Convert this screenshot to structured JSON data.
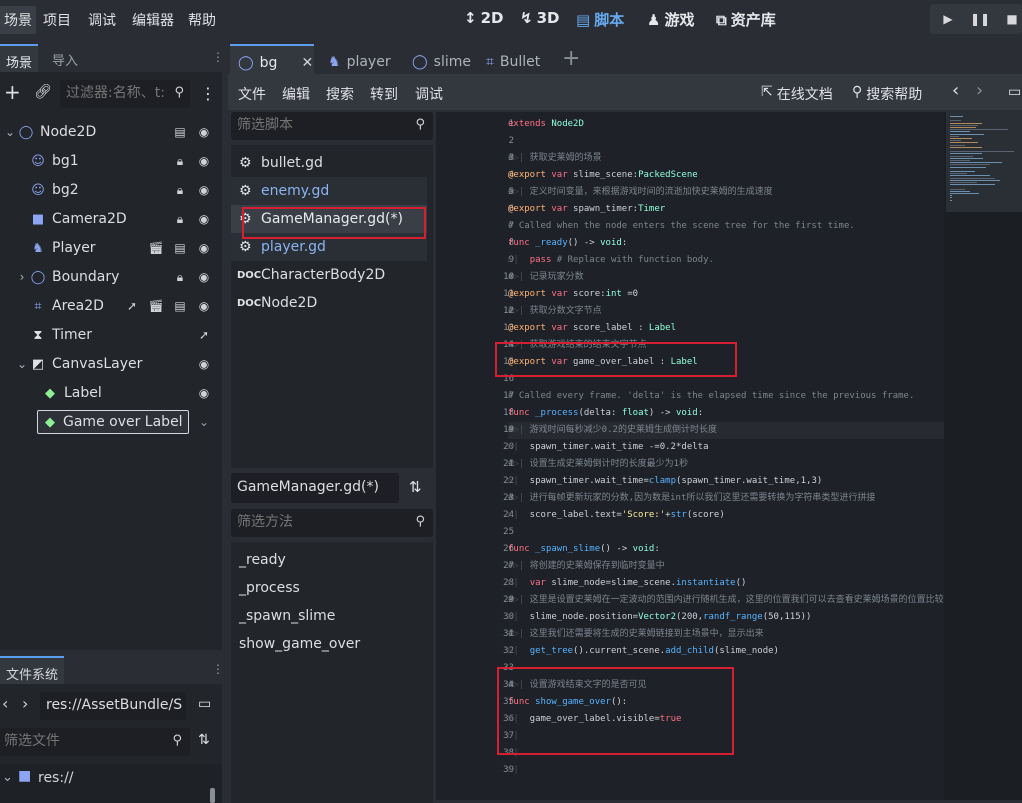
{
  "menu": {
    "items": [
      "场景",
      "项目",
      "调试",
      "编辑器",
      "帮助"
    ],
    "modes": [
      {
        "label": "2D",
        "icon": "2d-mode-icon"
      },
      {
        "label": "3D",
        "icon": "3d-mode-icon"
      },
      {
        "label": "脚本",
        "icon": "script-mode-icon"
      },
      {
        "label": "游戏",
        "icon": "game-mode-icon"
      },
      {
        "label": "资产库",
        "icon": "assetlib-icon"
      }
    ]
  },
  "scene_dock": {
    "tabs": [
      "场景",
      "导入"
    ],
    "filter_placeholder": "过滤器:名称、t:",
    "nodes": [
      {
        "name": "Node2D",
        "icon": "node2d-circle-icon"
      },
      {
        "name": "bg1",
        "icon": "sprite-icon"
      },
      {
        "name": "bg2",
        "icon": "sprite-icon"
      },
      {
        "name": "Camera2D",
        "icon": "camera-icon"
      },
      {
        "name": "Player",
        "icon": "character-icon"
      },
      {
        "name": "Boundary",
        "icon": "node2d-circle-icon"
      },
      {
        "name": "Area2D",
        "icon": "area2d-icon"
      },
      {
        "name": "Timer",
        "icon": "timer-icon"
      },
      {
        "name": "CanvasLayer",
        "icon": "canvaslayer-icon"
      },
      {
        "name": "Label",
        "icon": "label-icon"
      },
      {
        "name": "Game over Label",
        "icon": "label-icon"
      }
    ]
  },
  "fs_dock": {
    "tab": "文件系统",
    "path": "res://AssetBundle/S",
    "filter_placeholder": "筛选文件",
    "root": "res://"
  },
  "script_tabs": [
    {
      "label": "bg",
      "icon": "node2d-circle-icon"
    },
    {
      "label": "player",
      "icon": "character-icon"
    },
    {
      "label": "slime",
      "icon": "node2d-circle-icon"
    },
    {
      "label": "Bullet",
      "icon": "area2d-icon"
    }
  ],
  "script_menu": {
    "items": [
      "文件",
      "编辑",
      "搜索",
      "转到",
      "调试"
    ],
    "online_docs": "在线文档",
    "search_help": "搜索帮助"
  },
  "script_list": {
    "filter_placeholder": "筛选脚本",
    "items": [
      "bullet.gd",
      "enemy.gd",
      "GameManager.gd(*)",
      "player.gd",
      "CharacterBody2D",
      "Node2D"
    ]
  },
  "current_script": "GameManager.gd(*)",
  "method_list": {
    "filter_placeholder": "筛选方法",
    "items": [
      "_ready",
      "_process",
      "_spawn_slime",
      "show_game_over"
    ]
  },
  "code_lines": [
    "extends Node2D",
    "",
    "#▷| 获取史莱姆的场景",
    "@export var slime_scene:PackedScene",
    "#▷| 定义时间变量，来根据游戏时间的流逝加快史莱姆的生成速度",
    "@export var spawn_timer:Timer",
    "# Called when the node enters the scene tree for the first time.",
    "func _ready() -> void:",
    "▷|  pass # Replace with function body.",
    "#▷| 记录玩家分数",
    "@export var score:int =0",
    "#▷| 获取分数文字节点",
    "@export var score_label : Label",
    "#▷| 获取游戏结束的结束文字节点",
    "@export var game_over_label : Label",
    "",
    "# Called every frame. 'delta' is the elapsed time since the previous frame.",
    "func _process(delta: float) -> void:",
    "#▷| 游戏时间每秒减少0.2的史莱姆生成倒计时长度",
    "▷|  spawn_timer.wait_time -=0.2*delta",
    "#▷| 设置生成史莱姆倒计时的长度最少为1秒",
    "▷|  spawn_timer.wait_time=clamp(spawn_timer.wait_time,1,3)",
    "#▷| 进行每帧更新玩家的分数,因为数是int所以我们这里还需要转换为字符串类型进行拼接",
    "▷|  score_label.text='Score:'+str(score)",
    "",
    "func _spawn_slime() -> void:",
    "#▷| 将创建的史莱姆保存到临时变量中",
    "▷|  var slime_node=slime_scene.instantiate()",
    "#▷| 这里是设置史莱姆在一定波动的范围内进行随机生成，这里的位置我们可以去查看史莱姆场景的位置比较",
    "▷|  slime_node.position=Vector2(200,randf_range(50,115))",
    "#▷| 这里我们还需要将生成的史莱姆链接到主场景中，显示出来",
    "▷|  get_tree().current_scene.add_child(slime_node)",
    "",
    "#▷| 设置游戏结束文字的是否可见",
    "func show_game_over():",
    "▷|  game_over_label.visible=true",
    "▷|",
    "▷|",
    "▷|"
  ]
}
